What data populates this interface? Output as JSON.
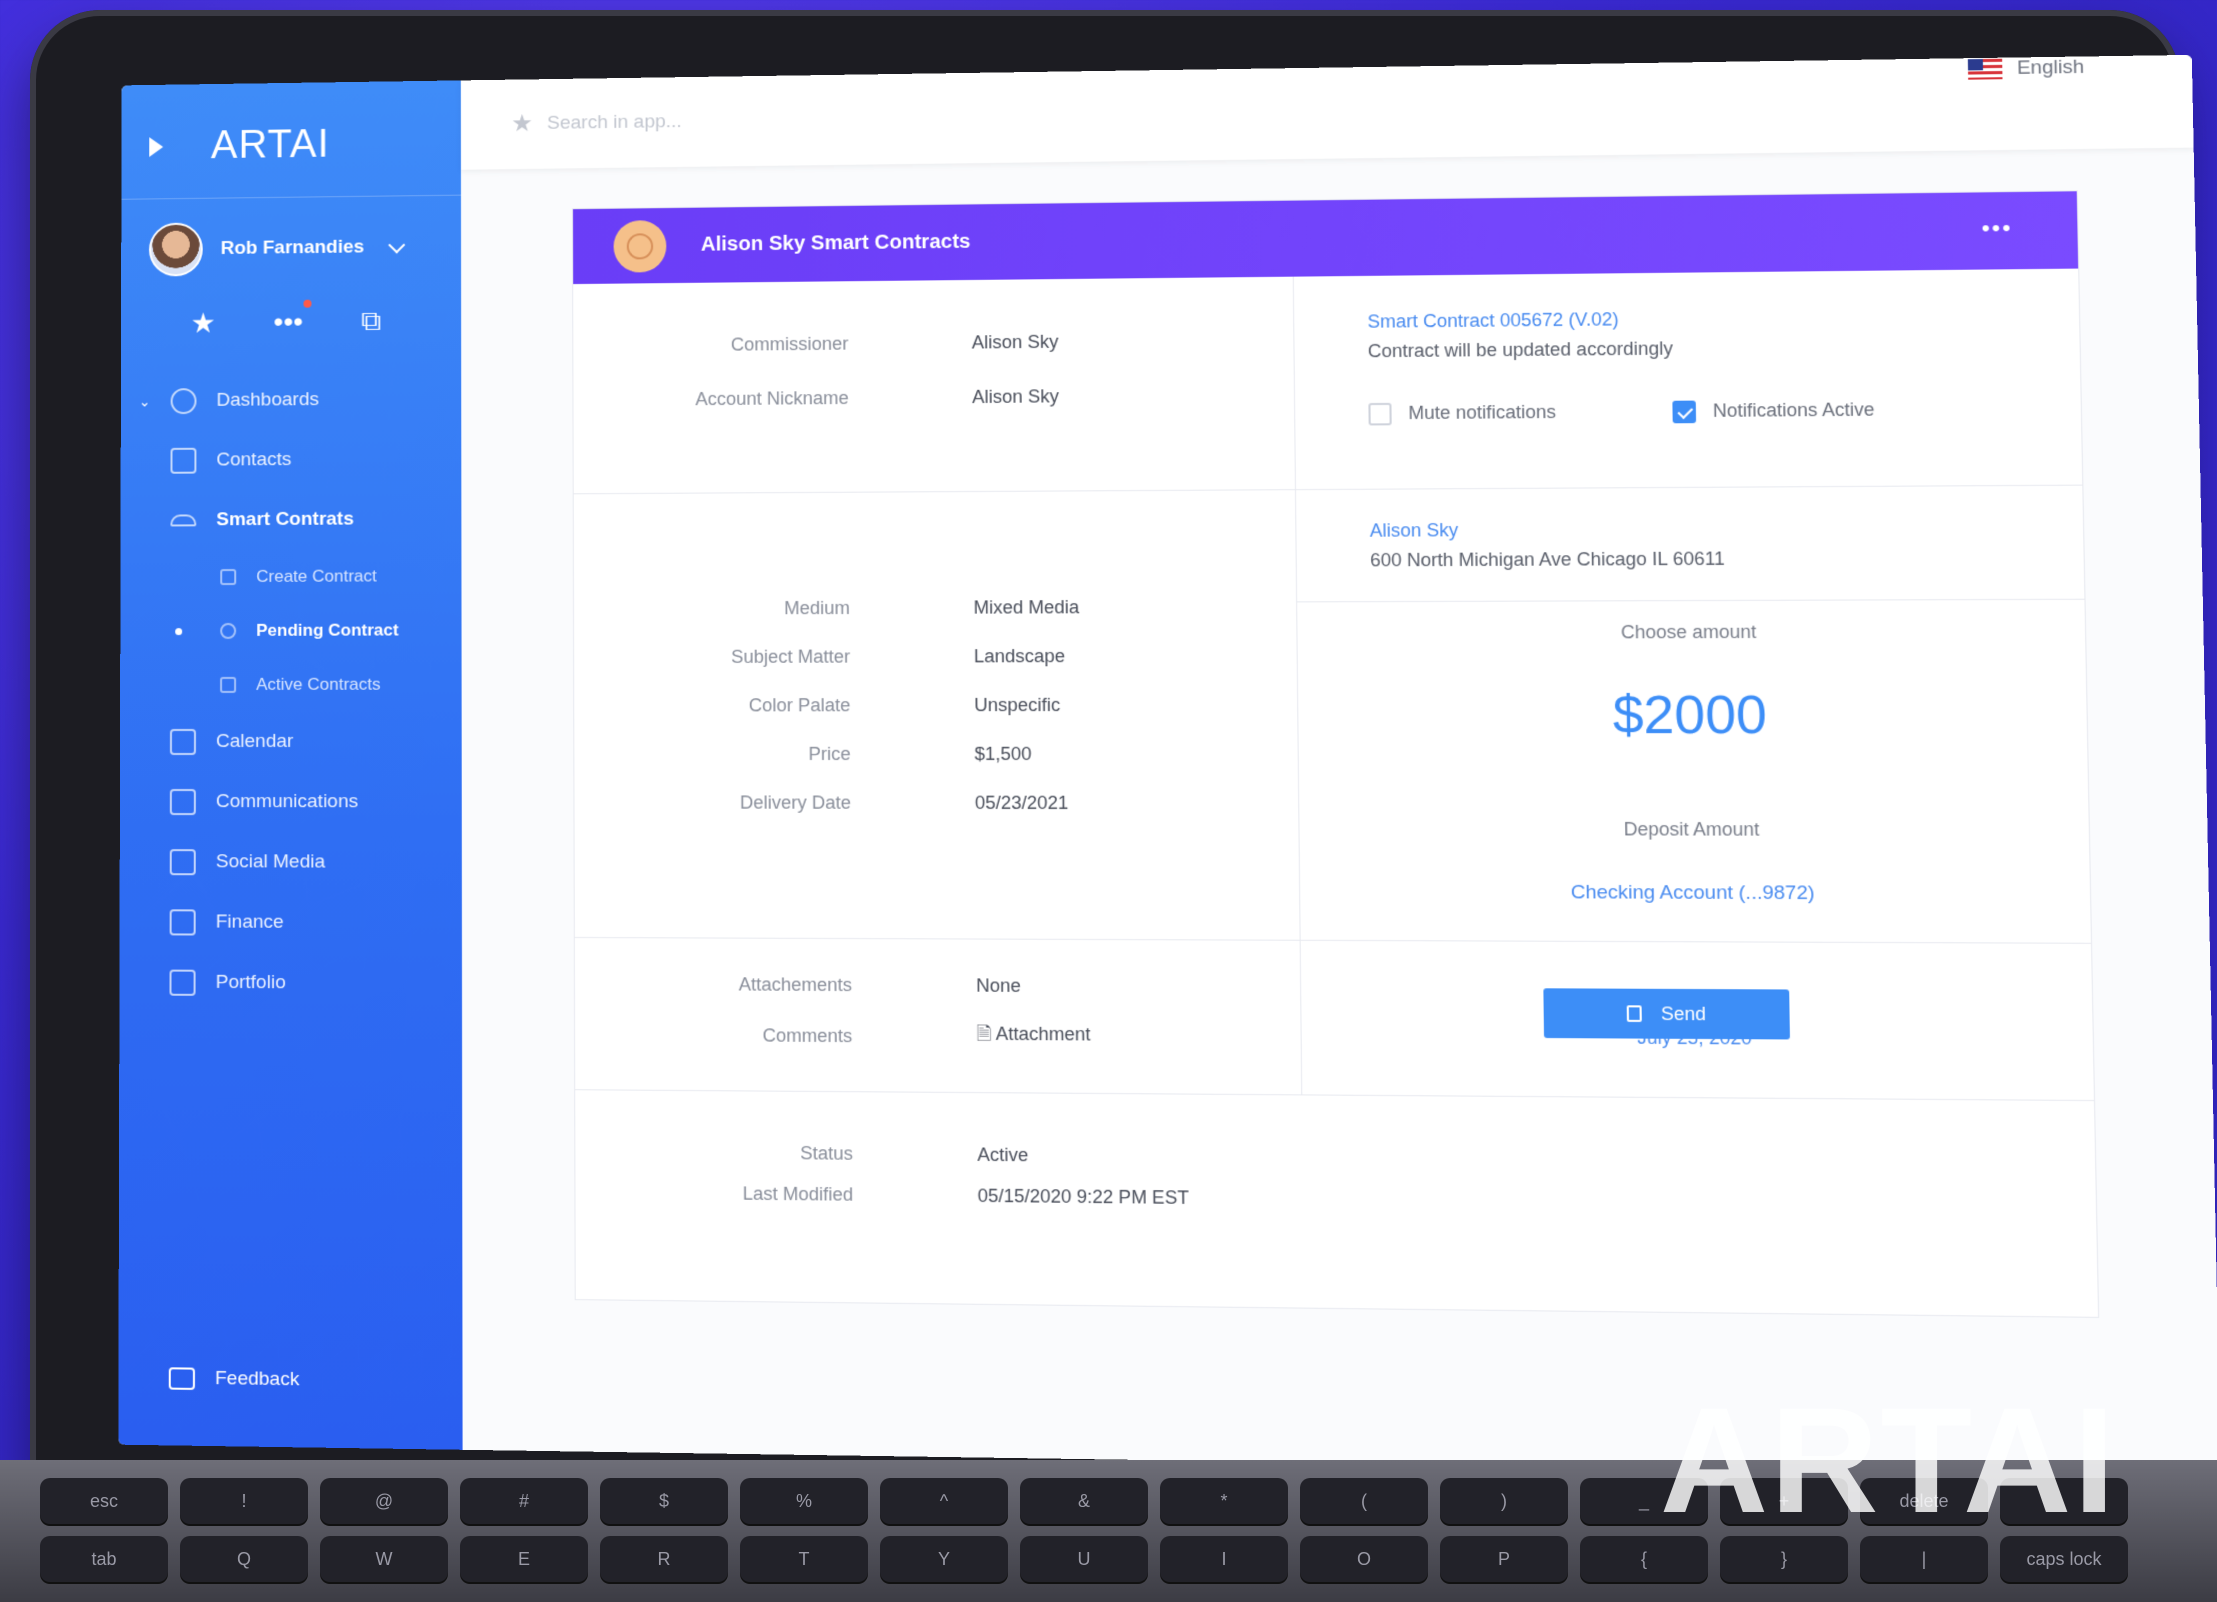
{
  "app": {
    "brand": "ARTAI",
    "watermark": "ARTAI"
  },
  "user": {
    "name": "Rob Farnandies"
  },
  "search": {
    "placeholder": "Search in app..."
  },
  "language": {
    "label": "English"
  },
  "nav": {
    "dashboards": "Dashboards",
    "contacts": "Contacts",
    "smart_contracts": "Smart Contrats",
    "create_contract": "Create Contract",
    "pending_contract": "Pending Contract",
    "active_contracts": "Active Contracts",
    "calendar": "Calendar",
    "communications": "Communications",
    "social_media": "Social Media",
    "finance": "Finance",
    "portfolio": "Portfolio",
    "feedback": "Feedback"
  },
  "card": {
    "title": "Alison Sky Smart Contracts",
    "more": "•••",
    "account": [
      {
        "label": "Commissioner",
        "value": "Alison Sky"
      },
      {
        "label": "Account Nickname",
        "value": "Alison Sky"
      }
    ],
    "details": [
      {
        "label": "Medium",
        "value": "Mixed Media"
      },
      {
        "label": "Subject Matter",
        "value": "Landscape"
      },
      {
        "label": "Color Palate",
        "value": "Unspecific"
      },
      {
        "label": "Price",
        "value": "$1,500"
      },
      {
        "label": "Delivery Date",
        "value": "05/23/2021"
      }
    ],
    "extras": [
      {
        "label": "Attachements",
        "value": "None"
      },
      {
        "label": "Comments",
        "value": "Attachment"
      }
    ],
    "status": [
      {
        "label": "Status",
        "value": "Active"
      },
      {
        "label": "Last Modified",
        "value": "05/15/2020 9:22 PM EST"
      }
    ],
    "contract": {
      "link": "Smart Contract 005672 (V.02)",
      "note": "Contract will be updated accordingly",
      "mute_label": "Mute notifications",
      "mute_checked": false,
      "notify_label": "Notifications Active",
      "notify_checked": true
    },
    "address": {
      "name": "Alison Sky",
      "line": "600 North Michigan Ave Chicago IL 60611"
    },
    "payment": {
      "choose_label": "Choose amount",
      "amount": "$2000",
      "deposit_label": "Deposit Amount",
      "account": "Checking Account (...9872)",
      "pay_label": "Pay Today",
      "pay_date": "July 25, 2020"
    },
    "send_label": "Send"
  },
  "keyboard": {
    "row1": [
      "esc",
      "!",
      "@",
      "#",
      "$",
      "%",
      "^",
      "&",
      "*",
      "(",
      ")",
      "_",
      "+",
      "delete",
      ""
    ],
    "row2": [
      "tab",
      "Q",
      "W",
      "E",
      "R",
      "T",
      "Y",
      "U",
      "I",
      "O",
      "P",
      "{",
      "}",
      "|",
      "caps lock"
    ]
  },
  "colors": {
    "sidebar": "#2f6ef3",
    "header": "#6a3df7",
    "accent": "#3d8ef7"
  }
}
